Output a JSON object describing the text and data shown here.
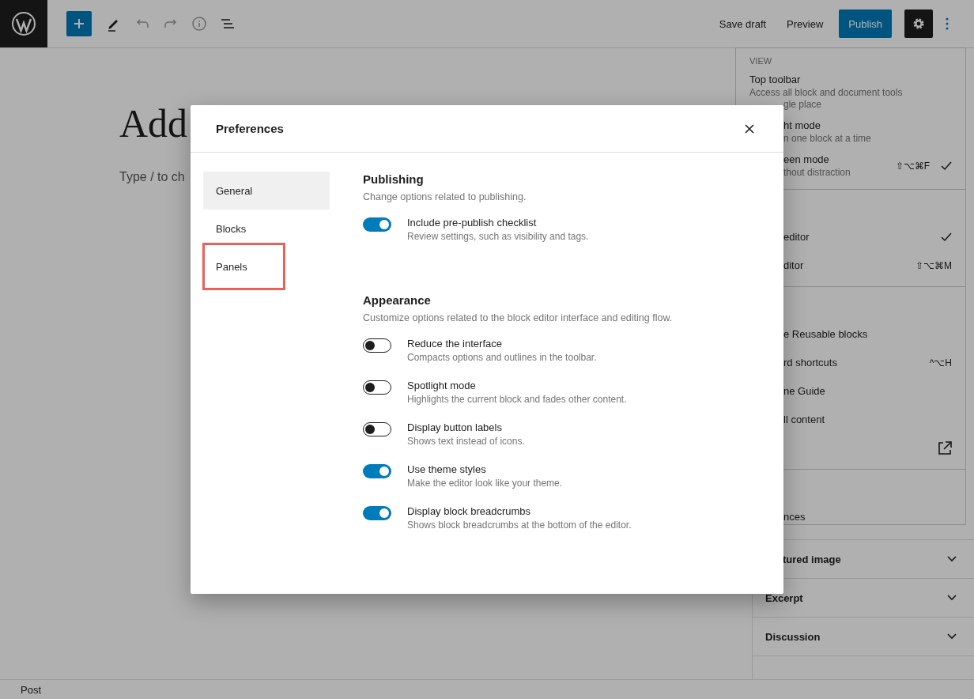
{
  "toolbar": {
    "buttons": [
      {
        "label": "Save draft",
        "kind": "secondary"
      },
      {
        "label": "Preview",
        "kind": "secondary"
      },
      {
        "label": "Publish",
        "kind": "primary"
      }
    ]
  },
  "editor": {
    "title_placeholder": "Add",
    "body_placeholder": "Type / to ch"
  },
  "sidebar": {
    "panels": [
      {
        "title": "tured image",
        "expanded": false,
        "clipped": true
      },
      {
        "title": "Excerpt",
        "expanded": false,
        "clipped": false
      },
      {
        "title": "Discussion",
        "expanded": false,
        "clipped": false
      }
    ]
  },
  "menu": {
    "sections": [
      {
        "heading": "VIEW",
        "items": [
          {
            "lines": [
              {
                "text": "Top toolbar",
                "kind": "label",
                "clipped": false
              },
              {
                "text": "Access all block and document tools",
                "kind": "desc",
                "clipped": false
              },
              {
                "text": "gle place",
                "kind": "desc",
                "clipped": true
              }
            ],
            "checked": false
          },
          {
            "lines": [
              {
                "text": "ht mode",
                "kind": "label",
                "clipped": true
              },
              {
                "text": "n one block at a time",
                "kind": "desc",
                "clipped": true
              }
            ],
            "checked": false
          },
          {
            "lines": [
              {
                "text": "een mode",
                "kind": "label",
                "clipped": true
              },
              {
                "text": "thout distraction",
                "kind": "desc",
                "clipped": true
              }
            ],
            "shortcut": "⇧⌥⌘F",
            "checked": true
          }
        ]
      },
      {
        "items": [
          {
            "lines": [
              {
                "text": "editor",
                "kind": "label",
                "clipped": true
              }
            ],
            "checked": true
          },
          {
            "lines": [
              {
                "text": "ditor",
                "kind": "label",
                "clipped": true
              }
            ],
            "shortcut": "⇧⌥⌘M",
            "checked": false
          }
        ]
      },
      {
        "items": [
          {
            "lines": [
              {
                "text": "e Reusable blocks",
                "kind": "label",
                "clipped": true
              }
            ],
            "checked": false
          },
          {
            "lines": [
              {
                "text": "rd shortcuts",
                "kind": "label",
                "clipped": true
              }
            ],
            "shortcut": "^⌥H",
            "checked": false
          },
          {
            "lines": [
              {
                "text": "ne Guide",
                "kind": "label",
                "clipped": true
              }
            ],
            "checked": false
          },
          {
            "lines": [
              {
                "text": "ll content",
                "kind": "label",
                "clipped": true
              }
            ],
            "checked": false
          },
          {
            "external": true,
            "checked": false
          }
        ]
      },
      {
        "items": [
          {
            "lines": [
              {
                "text": "nces",
                "kind": "label",
                "clipped": true
              }
            ],
            "checked": false
          }
        ]
      }
    ]
  },
  "status_bar": {
    "text": "Post"
  },
  "modal": {
    "title": "Preferences",
    "nav": [
      {
        "label": "General",
        "selected": true,
        "highlighted": false
      },
      {
        "label": "Blocks",
        "selected": false,
        "highlighted": false
      },
      {
        "label": "Panels",
        "selected": false,
        "highlighted": true
      }
    ],
    "sections": [
      {
        "title": "Publishing",
        "description": "Change options related to publishing.",
        "options": [
          {
            "label": "Include pre-publish checklist",
            "help": "Review settings, such as visibility and tags.",
            "on": true
          }
        ]
      },
      {
        "title": "Appearance",
        "description": "Customize options related to the block editor interface and editing flow.",
        "options": [
          {
            "label": "Reduce the interface",
            "help": "Compacts options and outlines in the toolbar.",
            "on": false
          },
          {
            "label": "Spotlight mode",
            "help": "Highlights the current block and fades other content.",
            "on": false
          },
          {
            "label": "Display button labels",
            "help": "Shows text instead of icons.",
            "on": false
          },
          {
            "label": "Use theme styles",
            "help": "Make the editor look like your theme.",
            "on": true
          },
          {
            "label": "Display block breadcrumbs",
            "help": "Shows block breadcrumbs at the bottom of the editor.",
            "on": true
          }
        ]
      }
    ]
  }
}
